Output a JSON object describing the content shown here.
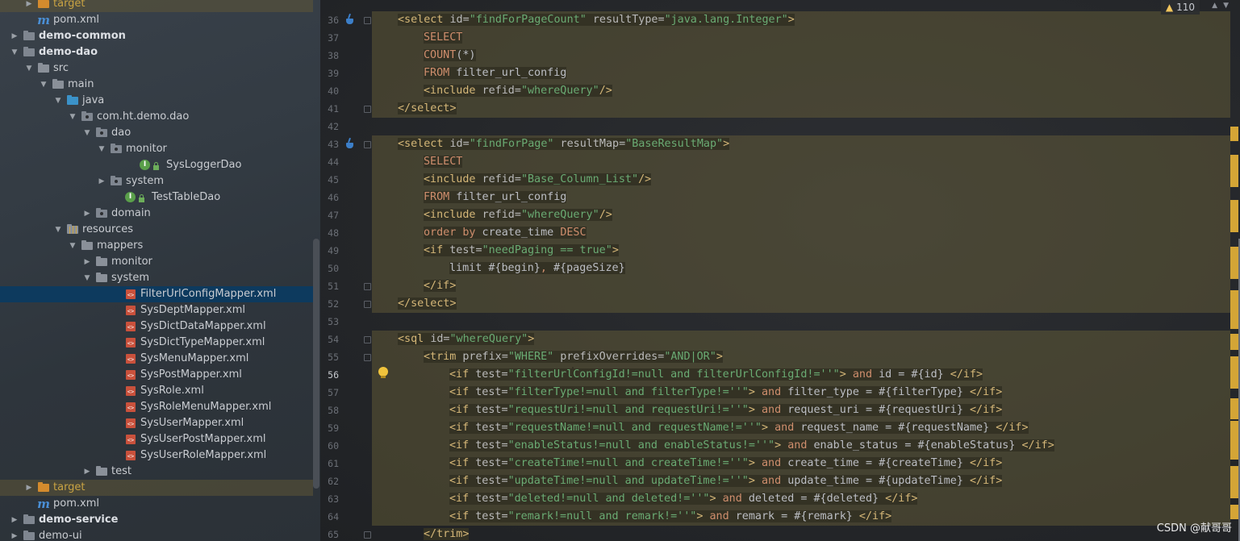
{
  "project_tree": {
    "items": [
      {
        "label": "target",
        "depth": 2,
        "icon": "folder-orange",
        "chevron": "right",
        "excluded": true
      },
      {
        "label": "pom.xml",
        "depth": 2,
        "icon": "maven-icon"
      },
      {
        "label": "demo-common",
        "depth": 1,
        "icon": "module-folder",
        "chevron": "right",
        "bold": true
      },
      {
        "label": "demo-dao",
        "depth": 1,
        "icon": "module-folder",
        "chevron": "down",
        "bold": true
      },
      {
        "label": "src",
        "depth": 2,
        "icon": "folder",
        "chevron": "down"
      },
      {
        "label": "main",
        "depth": 3,
        "icon": "folder",
        "chevron": "down"
      },
      {
        "label": "java",
        "depth": 4,
        "icon": "folder-blue",
        "chevron": "down"
      },
      {
        "label": "com.ht.demo.dao",
        "depth": 5,
        "icon": "package",
        "chevron": "down"
      },
      {
        "label": "dao",
        "depth": 6,
        "icon": "package",
        "chevron": "down"
      },
      {
        "label": "monitor",
        "depth": 7,
        "icon": "package",
        "chevron": "down"
      },
      {
        "label": "SysLoggerDao",
        "depth": 9,
        "icon": "interface"
      },
      {
        "label": "system",
        "depth": 7,
        "icon": "package",
        "chevron": "right"
      },
      {
        "label": "TestTableDao",
        "depth": 8,
        "icon": "interface"
      },
      {
        "label": "domain",
        "depth": 6,
        "icon": "package",
        "chevron": "right"
      },
      {
        "label": "resources",
        "depth": 4,
        "icon": "folder-res",
        "chevron": "down"
      },
      {
        "label": "mappers",
        "depth": 5,
        "icon": "folder",
        "chevron": "down"
      },
      {
        "label": "monitor",
        "depth": 6,
        "icon": "folder",
        "chevron": "right"
      },
      {
        "label": "system",
        "depth": 6,
        "icon": "folder",
        "chevron": "down"
      },
      {
        "label": "FilterUrlConfigMapper.xml",
        "depth": 8,
        "icon": "xml",
        "selected": true
      },
      {
        "label": "SysDeptMapper.xml",
        "depth": 8,
        "icon": "xml"
      },
      {
        "label": "SysDictDataMapper.xml",
        "depth": 8,
        "icon": "xml"
      },
      {
        "label": "SysDictTypeMapper.xml",
        "depth": 8,
        "icon": "xml"
      },
      {
        "label": "SysMenuMapper.xml",
        "depth": 8,
        "icon": "xml"
      },
      {
        "label": "SysPostMapper.xml",
        "depth": 8,
        "icon": "xml"
      },
      {
        "label": "SysRole.xml",
        "depth": 8,
        "icon": "xml"
      },
      {
        "label": "SysRoleMenuMapper.xml",
        "depth": 8,
        "icon": "xml"
      },
      {
        "label": "SysUserMapper.xml",
        "depth": 8,
        "icon": "xml"
      },
      {
        "label": "SysUserPostMapper.xml",
        "depth": 8,
        "icon": "xml"
      },
      {
        "label": "SysUserRoleMapper.xml",
        "depth": 8,
        "icon": "xml"
      },
      {
        "label": "test",
        "depth": 6,
        "icon": "folder",
        "chevron": "right"
      },
      {
        "label": "target",
        "depth": 2,
        "icon": "folder-orange",
        "chevron": "right",
        "excluded": true
      },
      {
        "label": "pom.xml",
        "depth": 2,
        "icon": "maven-icon"
      },
      {
        "label": "demo-service",
        "depth": 1,
        "icon": "module-folder",
        "chevron": "right",
        "bold": true
      },
      {
        "label": "demo-ui",
        "depth": 1,
        "icon": "module-folder",
        "chevron": "right"
      }
    ]
  },
  "editor": {
    "inspection": {
      "icon": "warning-icon",
      "count": "110"
    },
    "current_line": 56,
    "lines": [
      {
        "n": "36",
        "indent": 1,
        "tokens": [
          [
            "tg",
            "<select "
          ],
          [
            "at",
            "id="
          ],
          [
            "vl",
            "\"findForPageCount\""
          ],
          [
            "at",
            " resultType="
          ],
          [
            "vl",
            "\"java.lang.Integer\""
          ],
          [
            "tg",
            ">"
          ]
        ]
      },
      {
        "n": "37",
        "indent": 2,
        "tokens": [
          [
            "kw",
            "SELECT"
          ]
        ]
      },
      {
        "n": "38",
        "indent": 2,
        "tokens": [
          [
            "kw",
            "COUNT"
          ],
          [
            "sq",
            "(*)"
          ]
        ]
      },
      {
        "n": "39",
        "indent": 2,
        "tokens": [
          [
            "kw",
            "FROM"
          ],
          [
            "sq",
            " filter_url_config"
          ]
        ]
      },
      {
        "n": "40",
        "indent": 2,
        "tokens": [
          [
            "tg",
            "<include "
          ],
          [
            "at",
            "refid="
          ],
          [
            "vl",
            "\"whereQuery\""
          ],
          [
            "tg",
            "/>"
          ]
        ]
      },
      {
        "n": "41",
        "indent": 1,
        "tokens": [
          [
            "tg",
            "</select>"
          ]
        ]
      },
      {
        "n": "42",
        "indent": 0,
        "tokens": []
      },
      {
        "n": "43",
        "indent": 1,
        "tokens": [
          [
            "tg",
            "<select "
          ],
          [
            "at",
            "id="
          ],
          [
            "vl",
            "\"findForPage\""
          ],
          [
            "at",
            " resultMap="
          ],
          [
            "vl",
            "\"BaseResultMap\""
          ],
          [
            "tg",
            ">"
          ]
        ]
      },
      {
        "n": "44",
        "indent": 2,
        "tokens": [
          [
            "kw",
            "SELECT"
          ]
        ]
      },
      {
        "n": "45",
        "indent": 2,
        "tokens": [
          [
            "tg",
            "<include "
          ],
          [
            "at",
            "refid="
          ],
          [
            "vl",
            "\"Base_Column_List\""
          ],
          [
            "tg",
            "/>"
          ]
        ]
      },
      {
        "n": "46",
        "indent": 2,
        "tokens": [
          [
            "kw",
            "FROM"
          ],
          [
            "sq",
            " filter_url_config"
          ]
        ]
      },
      {
        "n": "47",
        "indent": 2,
        "tokens": [
          [
            "tg",
            "<include "
          ],
          [
            "at",
            "refid="
          ],
          [
            "vl",
            "\"whereQuery\""
          ],
          [
            "tg",
            "/>"
          ]
        ]
      },
      {
        "n": "48",
        "indent": 2,
        "tokens": [
          [
            "kw",
            "order by"
          ],
          [
            "sq",
            " create_time "
          ],
          [
            "kw",
            "DESC"
          ]
        ]
      },
      {
        "n": "49",
        "indent": 2,
        "tokens": [
          [
            "tg",
            "<if "
          ],
          [
            "at",
            "test="
          ],
          [
            "vl",
            "\"needPaging == true\""
          ],
          [
            "tg",
            ">"
          ]
        ]
      },
      {
        "n": "50",
        "indent": 3,
        "tokens": [
          [
            "sq",
            "limit #{begin}"
          ],
          [
            "kw",
            ","
          ],
          [
            "sq",
            " #{pageSize}"
          ]
        ]
      },
      {
        "n": "51",
        "indent": 2,
        "tokens": [
          [
            "tg",
            "</if>"
          ]
        ]
      },
      {
        "n": "52",
        "indent": 1,
        "tokens": [
          [
            "tg",
            "</select>"
          ]
        ]
      },
      {
        "n": "53",
        "indent": 0,
        "tokens": []
      },
      {
        "n": "54",
        "indent": 1,
        "tokens": [
          [
            "tg",
            "<sql "
          ],
          [
            "at",
            "id="
          ],
          [
            "vl",
            "\"whereQuery\""
          ],
          [
            "tg",
            ">"
          ]
        ]
      },
      {
        "n": "55",
        "indent": 2,
        "tokens": [
          [
            "tg",
            "<trim "
          ],
          [
            "at",
            "prefix="
          ],
          [
            "vl",
            "\"WHERE\""
          ],
          [
            "at",
            " prefixOverrides="
          ],
          [
            "vl",
            "\"AND|OR\""
          ],
          [
            "tg",
            ">"
          ]
        ]
      },
      {
        "n": "56",
        "indent": 3,
        "tokens": [
          [
            "tg",
            "<if "
          ],
          [
            "at",
            "test="
          ],
          [
            "vl",
            "\"filterUrl"
          ],
          [
            "caret",
            ""
          ],
          [
            "vl",
            "ConfigId!=null and filterUrlConfigId!=''\""
          ],
          [
            "tg",
            ">"
          ],
          [
            "kw",
            " and"
          ],
          [
            "sq",
            " id = #{id} "
          ],
          [
            "tg",
            "</if>"
          ]
        ]
      },
      {
        "n": "57",
        "indent": 3,
        "tokens": [
          [
            "tg",
            "<if "
          ],
          [
            "at",
            "test="
          ],
          [
            "vl",
            "\"filterType!=null and filterType!=''\""
          ],
          [
            "tg",
            ">"
          ],
          [
            "kw",
            " and"
          ],
          [
            "sq",
            " filter_type = #{filterType} "
          ],
          [
            "tg",
            "</if>"
          ]
        ]
      },
      {
        "n": "58",
        "indent": 3,
        "tokens": [
          [
            "tg",
            "<if "
          ],
          [
            "at",
            "test="
          ],
          [
            "vl",
            "\"requestUri!=null and requestUri!=''\""
          ],
          [
            "tg",
            ">"
          ],
          [
            "kw",
            " and"
          ],
          [
            "sq",
            " request_uri = #{requestUri} "
          ],
          [
            "tg",
            "</if>"
          ]
        ]
      },
      {
        "n": "59",
        "indent": 3,
        "tokens": [
          [
            "tg",
            "<if "
          ],
          [
            "at",
            "test="
          ],
          [
            "vl",
            "\"requestName!=null and requestName!=''\""
          ],
          [
            "tg",
            ">"
          ],
          [
            "kw",
            " and"
          ],
          [
            "sq",
            " request_name = #{requestName} "
          ],
          [
            "tg",
            "</if>"
          ]
        ]
      },
      {
        "n": "60",
        "indent": 3,
        "tokens": [
          [
            "tg",
            "<if "
          ],
          [
            "at",
            "test="
          ],
          [
            "vl",
            "\"enableStatus!=null and enableStatus!=''\""
          ],
          [
            "tg",
            ">"
          ],
          [
            "kw",
            " and"
          ],
          [
            "sq",
            " enable_status = #{enableStatus} "
          ],
          [
            "tg",
            "</if>"
          ]
        ]
      },
      {
        "n": "61",
        "indent": 3,
        "tokens": [
          [
            "tg",
            "<if "
          ],
          [
            "at",
            "test="
          ],
          [
            "vl",
            "\"createTime!=null and createTime!=''\""
          ],
          [
            "tg",
            ">"
          ],
          [
            "kw",
            " and"
          ],
          [
            "sq",
            " create_time = #{createTime} "
          ],
          [
            "tg",
            "</if>"
          ]
        ]
      },
      {
        "n": "62",
        "indent": 3,
        "tokens": [
          [
            "tg",
            "<if "
          ],
          [
            "at",
            "test="
          ],
          [
            "vl",
            "\"updateTime!=null and updateTime!=''\""
          ],
          [
            "tg",
            ">"
          ],
          [
            "kw",
            " and"
          ],
          [
            "sq",
            " update_time = #{updateTime} "
          ],
          [
            "tg",
            "</if>"
          ]
        ]
      },
      {
        "n": "63",
        "indent": 3,
        "tokens": [
          [
            "tg",
            "<if "
          ],
          [
            "at",
            "test="
          ],
          [
            "vl",
            "\"deleted!=null and deleted!=''\""
          ],
          [
            "tg",
            ">"
          ],
          [
            "kw",
            " and"
          ],
          [
            "sq",
            " deleted = #{deleted} "
          ],
          [
            "tg",
            "</if>"
          ]
        ]
      },
      {
        "n": "64",
        "indent": 3,
        "tokens": [
          [
            "tg",
            "<if "
          ],
          [
            "at",
            "test="
          ],
          [
            "vl",
            "\"remark!=null and remark!=''\""
          ],
          [
            "tg",
            ">"
          ],
          [
            "kw",
            " and"
          ],
          [
            "sq",
            " remark = #{remark} "
          ],
          [
            "tg",
            "</if>"
          ]
        ]
      },
      {
        "n": "65",
        "indent": 2,
        "tokens": [
          [
            "tg",
            "</trim>"
          ]
        ]
      }
    ]
  },
  "watermark": "CSDN @献哥哥",
  "colors": {
    "tag": "#d5b778",
    "attribute": "#bababa",
    "value": "#6aab73",
    "keyword": "#cf8e6d",
    "selection": "#0d3a5e"
  }
}
